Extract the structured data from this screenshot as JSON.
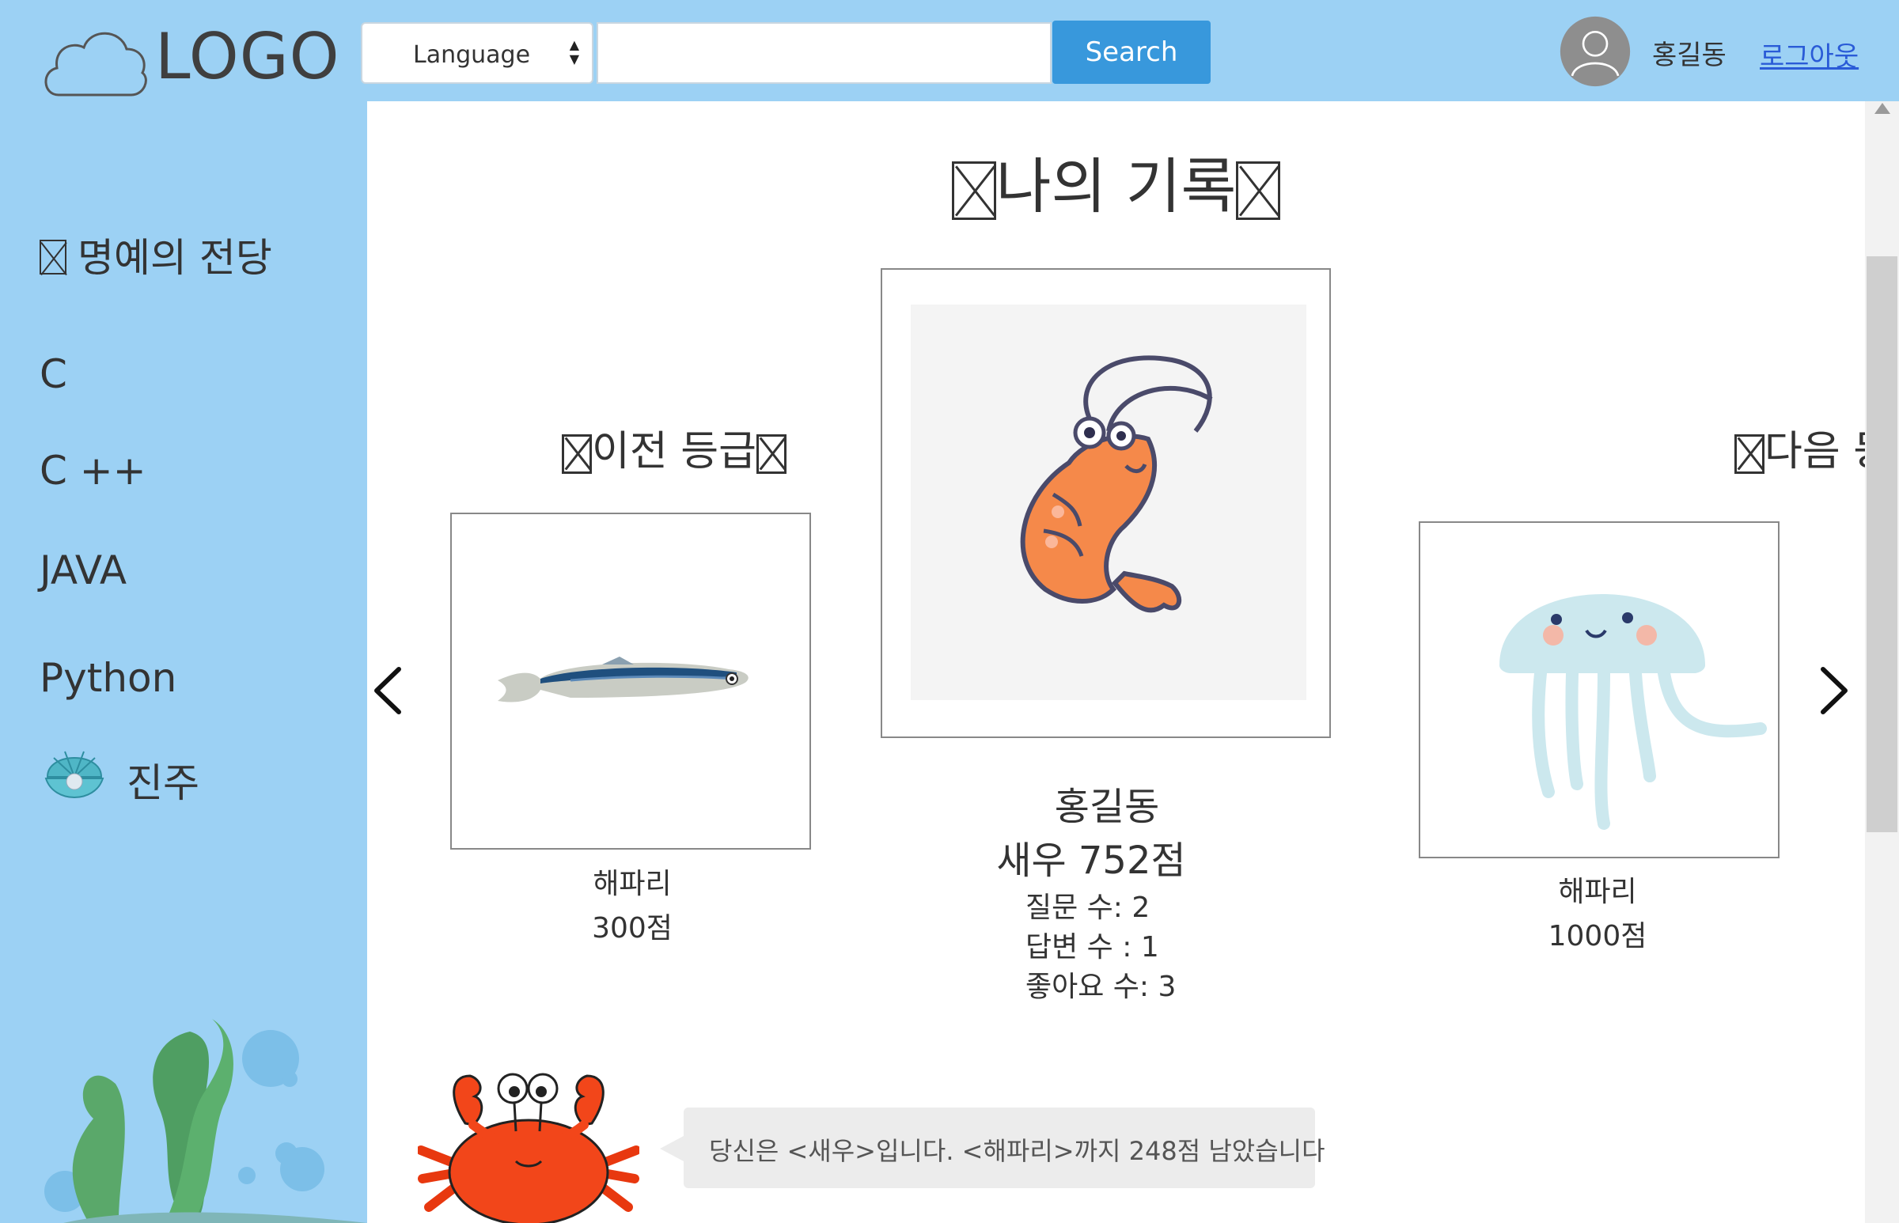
{
  "header": {
    "logo_text": "LOGO",
    "language_label": "Language",
    "search_value": "",
    "search_button": "Search",
    "username": "홍길동",
    "logout_label": "로그아웃"
  },
  "sidebar": {
    "hall_of_fame": "명예의 전당",
    "items": [
      "C",
      "C ++",
      "JAVA",
      "Python"
    ],
    "grade_label": "진주"
  },
  "main": {
    "title": "나의 기록",
    "prev_title": "이전 등급",
    "next_title": "다음 등급",
    "prev": {
      "name": "해파리",
      "score": "300점"
    },
    "current": {
      "username": "홍길동",
      "grade_score": "새우 752점",
      "questions": "질문 수: 2",
      "answers": "답변 수 : 1",
      "likes": "좋아요 수: 3"
    },
    "next": {
      "name": "해파리",
      "score": "1000점"
    },
    "message": "당신은 <새우>입니다. <해파리>까지 248점 남았습니다"
  },
  "colors": {
    "background": "#9cd1f4",
    "search_button": "#3898dc",
    "link": "#2a5bd7"
  }
}
